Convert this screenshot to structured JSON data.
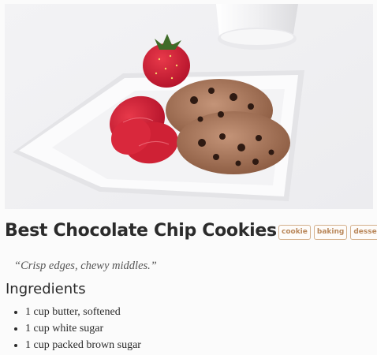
{
  "recipe": {
    "title": "Best Chocolate Chip Cookies",
    "tags": [
      "cookie",
      "baking",
      "dessert"
    ],
    "tagline": "“Crisp edges, chewy middles.”",
    "ingredients_heading": "Ingredients",
    "ingredients": [
      "1 cup butter, softened",
      "1 cup white sugar",
      "1 cup packed brown sugar"
    ]
  },
  "colors": {
    "tag_border": "#d4b08c",
    "tag_text": "#b9875a",
    "title_text": "#2b2b2b"
  }
}
